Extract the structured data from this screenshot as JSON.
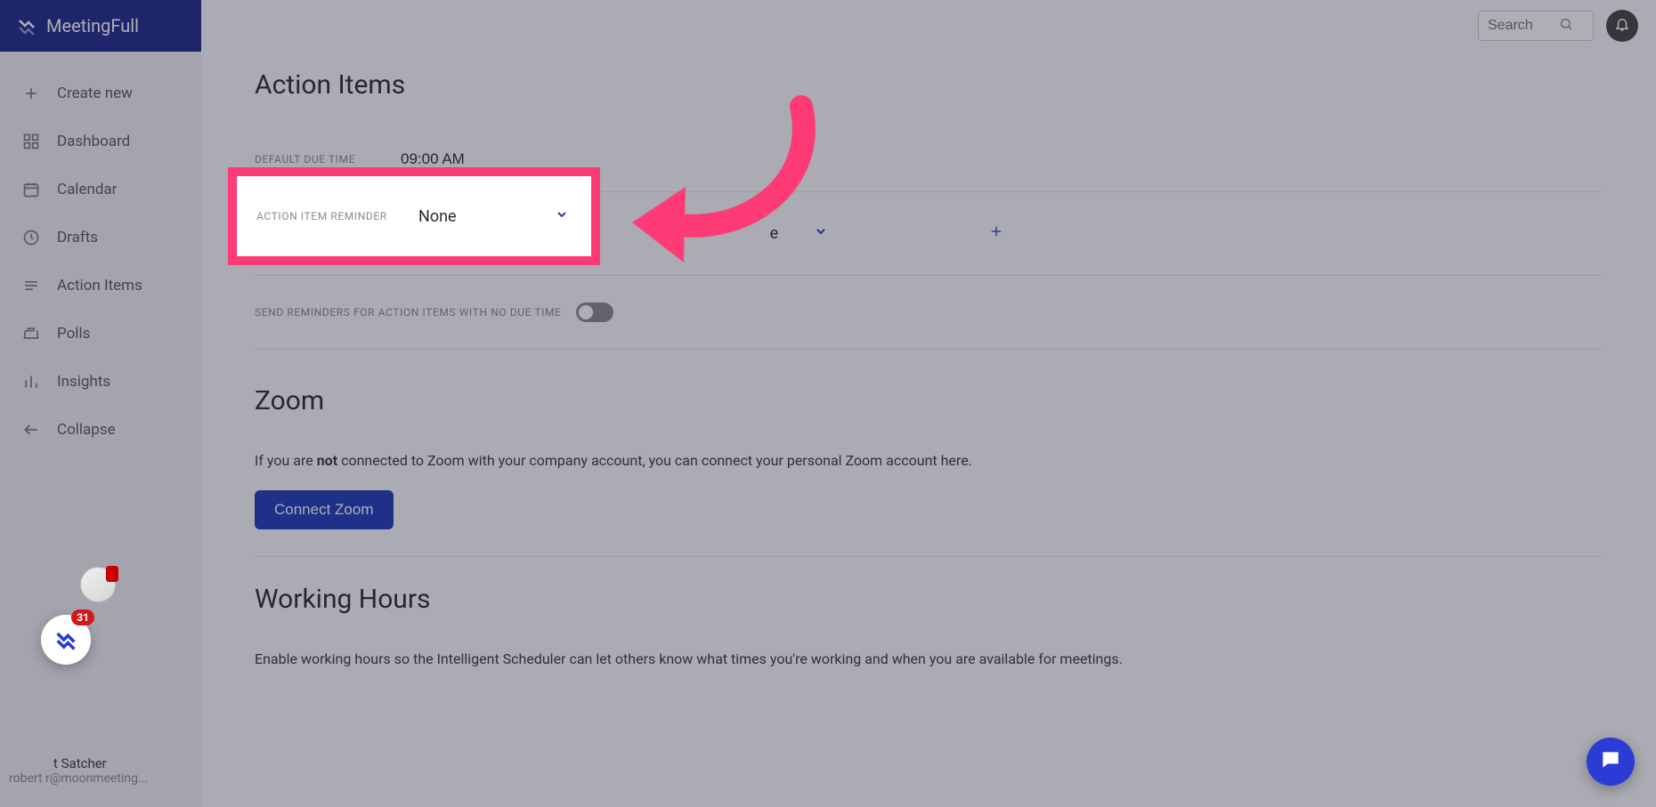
{
  "brand": "MeetingFull",
  "sidebar": {
    "create": "Create new",
    "items": [
      {
        "label": "Dashboard",
        "icon": "grid-icon"
      },
      {
        "label": "Calendar",
        "icon": "calendar-icon"
      },
      {
        "label": "Drafts",
        "icon": "clock-icon"
      },
      {
        "label": "Action Items",
        "icon": "list-icon"
      },
      {
        "label": "Polls",
        "icon": "polls-icon"
      },
      {
        "label": "Insights",
        "icon": "bars-icon"
      }
    ],
    "collapse": "Collapse"
  },
  "user": {
    "name": "t Satcher",
    "email": "robert           r@moonmeeting..."
  },
  "topbar": {
    "search_placeholder": "Search"
  },
  "sections": {
    "action_items": {
      "title": "Action Items",
      "default_due_time_label": "DEFAULT DUE TIME",
      "default_due_time_value": "09:00 AM",
      "reminder_label": "ACTION ITEM REMINDER",
      "reminder_value": "None",
      "second_reminder_value_tail": "e",
      "send_reminders_label": "SEND REMINDERS FOR ACTION ITEMS WITH NO DUE TIME"
    },
    "zoom": {
      "title": "Zoom",
      "desc_pre": "If you are ",
      "desc_bold": "not",
      "desc_post": " connected to Zoom with your company account, you can connect your personal Zoom account here.",
      "button": "Connect Zoom"
    },
    "working_hours": {
      "title": "Working Hours",
      "desc": "Enable working hours so the Intelligent Scheduler can let others know what times you're working and when you are available for meetings."
    }
  },
  "badge_count": "31"
}
